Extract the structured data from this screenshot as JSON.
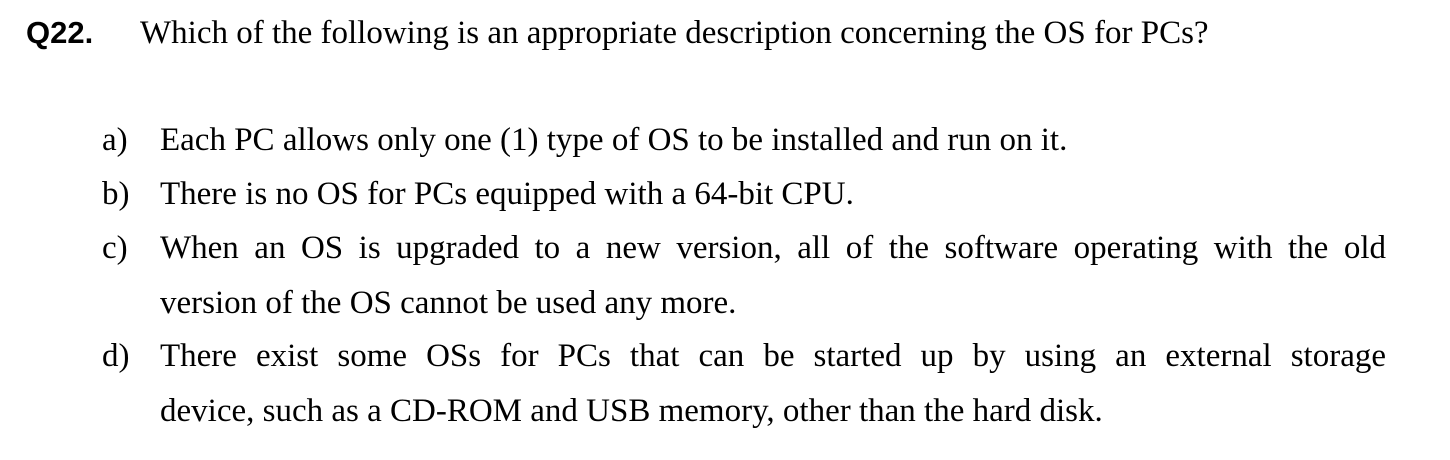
{
  "question": {
    "number": "Q22.",
    "stem": "Which of the following is an appropriate description concerning the OS for PCs?"
  },
  "options": [
    {
      "label": "a)",
      "lines": [
        "Each PC allows only one (1) type of OS to be installed and run on it."
      ]
    },
    {
      "label": "b)",
      "lines": [
        "There is no OS for PCs equipped with a 64-bit CPU."
      ]
    },
    {
      "label": "c)",
      "lines": [
        "When an OS is upgraded to a new version, all of the software operating with the old",
        "version of the OS cannot be used any more."
      ]
    },
    {
      "label": "d)",
      "lines": [
        "There exist some OSs for PCs that can be started up by using an external storage",
        "device, such as a CD-ROM and USB memory, other than the hard disk."
      ]
    }
  ]
}
